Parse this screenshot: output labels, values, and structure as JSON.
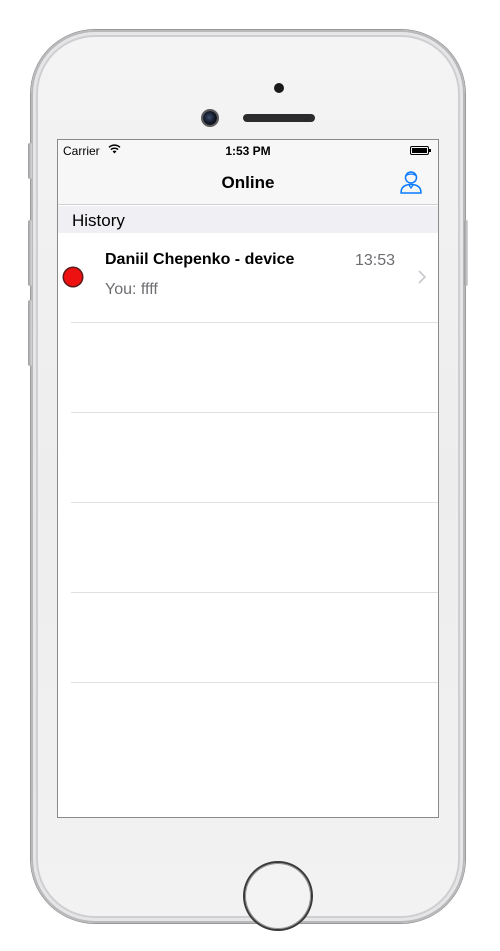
{
  "status_bar": {
    "carrier": "Carrier",
    "time": "1:53 PM",
    "wifi_icon": "wifi-icon",
    "battery_icon": "battery-icon"
  },
  "nav": {
    "title": "Online",
    "right_icon": "profile-icon",
    "accent_color": "#0a7aff"
  },
  "history": {
    "section_title": "History",
    "chats": [
      {
        "name": "Daniil Chepenko - device",
        "time": "13:53",
        "preview": "You: ffff",
        "status_color": "#ee1111",
        "chevron_icon": "chevron-right-icon"
      }
    ]
  },
  "device": {
    "home_button_icon": "home-button"
  }
}
